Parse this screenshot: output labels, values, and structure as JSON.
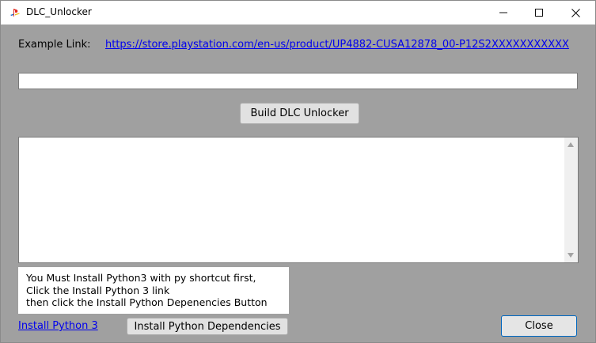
{
  "window": {
    "title": "DLC_Unlocker",
    "icon": "playstation-logo-icon"
  },
  "window_controls": {
    "minimize_icon": "minimize-icon",
    "maximize_icon": "maximize-icon",
    "close_icon": "close-icon"
  },
  "example": {
    "label": "Example Link:",
    "link": "https://store.playstation.com/en-us/product/UP4882-CUSA12878_00-P12S2XXXXXXXXXXX"
  },
  "url_input": {
    "value": "",
    "placeholder": ""
  },
  "build_button": {
    "label": "Build DLC Unlocker"
  },
  "output": {
    "text": ""
  },
  "info": {
    "lines": [
      "You Must Install Python3 with py shortcut first,",
      "Click the Install Python 3 link",
      "then click the Install Python Depenencies Button"
    ]
  },
  "install_python_link": "Install Python 3",
  "install_deps_button": "Install Python Dependencies",
  "close_button": "Close",
  "colors": {
    "window_bg": "#a0a0a0",
    "link": "#0000ee",
    "focus_border": "#0067c0"
  }
}
